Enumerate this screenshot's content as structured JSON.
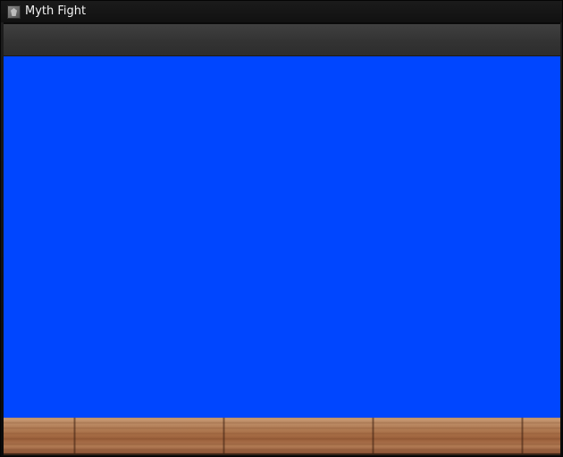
{
  "window": {
    "title": "Myth Fight",
    "app_icon": "myth-fight-app-icon"
  },
  "stage": {
    "background_color": "#0046ff"
  },
  "floor": {
    "texture": "wood-plank"
  }
}
